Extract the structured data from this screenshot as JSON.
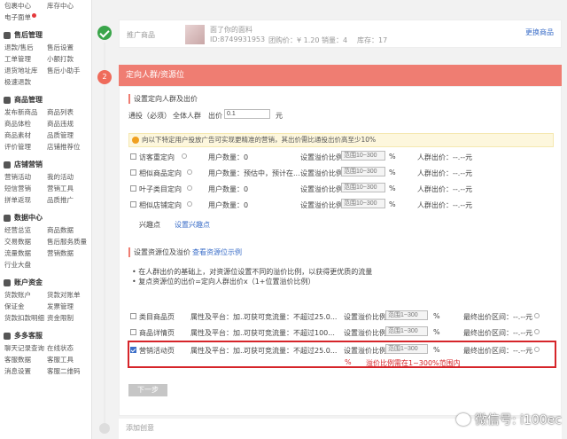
{
  "sidebar": {
    "top_rows": [
      [
        "包裹中心",
        "库存中心"
      ],
      [
        "电子面单",
        ""
      ]
    ],
    "sections": [
      {
        "title": "售后管理",
        "rows": [
          [
            "退款/售后",
            "售后设置"
          ],
          [
            "工单管理",
            "小额打款"
          ],
          [
            "退货地址库",
            "售后小助手"
          ],
          [
            "极速退款",
            ""
          ]
        ]
      },
      {
        "title": "商品管理",
        "rows": [
          [
            "发布新商品",
            "商品列表"
          ],
          [
            "商品体检",
            "商品违规"
          ],
          [
            "商品素材",
            "品质管理"
          ],
          [
            "评价管理",
            "店铺推荐位"
          ]
        ]
      },
      {
        "title": "店铺营销",
        "rows": [
          [
            "营销活动",
            "我的活动"
          ],
          [
            "短信营销",
            "营销工具"
          ],
          [
            "拼单返现",
            "品质推广"
          ]
        ]
      },
      {
        "title": "数据中心",
        "rows": [
          [
            "经营总览",
            "商品数据"
          ],
          [
            "交易数据",
            "售后服务质量"
          ],
          [
            "流量数据",
            "营销数据"
          ],
          [
            "行业大盘",
            ""
          ]
        ]
      },
      {
        "title": "账户资金",
        "rows": [
          [
            "货款账户",
            "货款对账单"
          ],
          [
            "保证金",
            "发票管理"
          ],
          [
            "货款扣款明细",
            "资金限制"
          ]
        ]
      },
      {
        "title": "多多客服",
        "rows": [
          [
            "聊天记录查询",
            "在线状态"
          ],
          [
            "客服数据",
            "客服工具"
          ],
          [
            "消息设置",
            "客服二维码"
          ]
        ]
      }
    ]
  },
  "product_line": {
    "label": "推广商品",
    "title": "面了你的面料",
    "id_text": "ID:8749931953",
    "price_text": "团购价：¥ 1.20",
    "stock_text": "销量：4",
    "cost_text": "库存：17",
    "change_link": "更换商品"
  },
  "step2": {
    "number": "2",
    "title": "定向人群/资源位",
    "section1_title": "设置定向人群及出价",
    "bid_label": "通投（必须）",
    "all_people": "全体人群",
    "bid_word": "出价",
    "bid_value": "0.1",
    "bid_unit": "元",
    "notice": "向以下特定用户投放广告可实现更精准的营销，其出价需比通投出价高至少10%",
    "rows": [
      {
        "name": "访客重定向",
        "count": "用户数量：0",
        "label": "设置溢价比例",
        "ph": "范围10~300",
        "pct": "%",
        "price": "人群出价：--.--元"
      },
      {
        "name": "相似商品定向",
        "count": "用户数量：预估中，预计在...",
        "label": "设置溢价比例",
        "ph": "范围10~300",
        "pct": "%",
        "price": "人群出价：--.--元"
      },
      {
        "name": "叶子类目定向",
        "count": "用户数量：0",
        "label": "设置溢价比例",
        "ph": "范围10~300",
        "pct": "%",
        "price": "人群出价：--.--元"
      },
      {
        "name": "相似店铺定向",
        "count": "用户数量：0",
        "label": "设置溢价比例",
        "ph": "范围10~300",
        "pct": "%",
        "price": "人群出价：--.--元"
      }
    ],
    "interest_label": "兴趣点",
    "interest_link": "设置兴趣点",
    "section2_title": "设置资源位及溢价",
    "section2_link": "查看资源位示例",
    "bullets": [
      "在人群出价的基础上，对资源位设置不同的溢价比例，以获得更优质的流量",
      "复点资源位的出价=定向人群出价x（1+位置溢价比例）"
    ],
    "resources": [
      {
        "name": "类目商品页",
        "attr": "属性及平台：加...",
        "flow": "可获可竞流量：不超过25.0...",
        "label": "设置溢价比例",
        "ph": "范围1~300",
        "pct": "%",
        "final": "最终出价区间：--.--元"
      },
      {
        "name": "商品详情页",
        "attr": "属性及平台：加...",
        "flow": "可获可竞流量：不超过100...",
        "label": "设置溢价比例",
        "ph": "范围1~300",
        "pct": "%",
        "final": "最终出价区间：--.--元"
      },
      {
        "name": "营销活动页",
        "attr": "属性及平台：加...",
        "flow": "可获可竞流量：不超过25.0...",
        "label": "设置溢价比例",
        "ph": "范围1~300",
        "pct": "%",
        "final": "最终出价区间：--.--元"
      }
    ],
    "error_text": "溢价比例需在1~300%范围内",
    "error_pct": "%",
    "next_button": "下一步"
  },
  "step3": {
    "title": "添加创意"
  },
  "watermark": "微信号: i100ec",
  "colors": {
    "accent_red": "#ef7d72",
    "success_green": "#3aa54a",
    "link_blue": "#3b6ec8",
    "highlight": "#d6252a"
  }
}
